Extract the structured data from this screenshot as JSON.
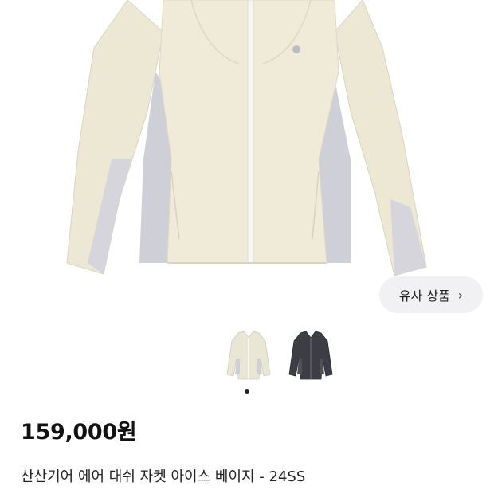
{
  "hero": {
    "image_subject": "ivory jacket with grey side panels",
    "colors": {
      "body": "#ece8d3",
      "panel": "#cfcfd8",
      "zipper": "#f6f6f2",
      "background": "#ffffff"
    }
  },
  "similar_button": {
    "label": "유사 상품",
    "icon": "chevron-right-icon"
  },
  "thumbnails": [
    {
      "name": "ivory",
      "color": "#e9e6d3"
    },
    {
      "name": "black",
      "color": "#3c3e44"
    }
  ],
  "pagination": {
    "active": 1,
    "count": 1,
    "active_color": "#222222"
  },
  "product": {
    "price": "159,000원",
    "title": "산산기어 에어 대쉬 자켓 아이스 베이지 - 24SS"
  }
}
